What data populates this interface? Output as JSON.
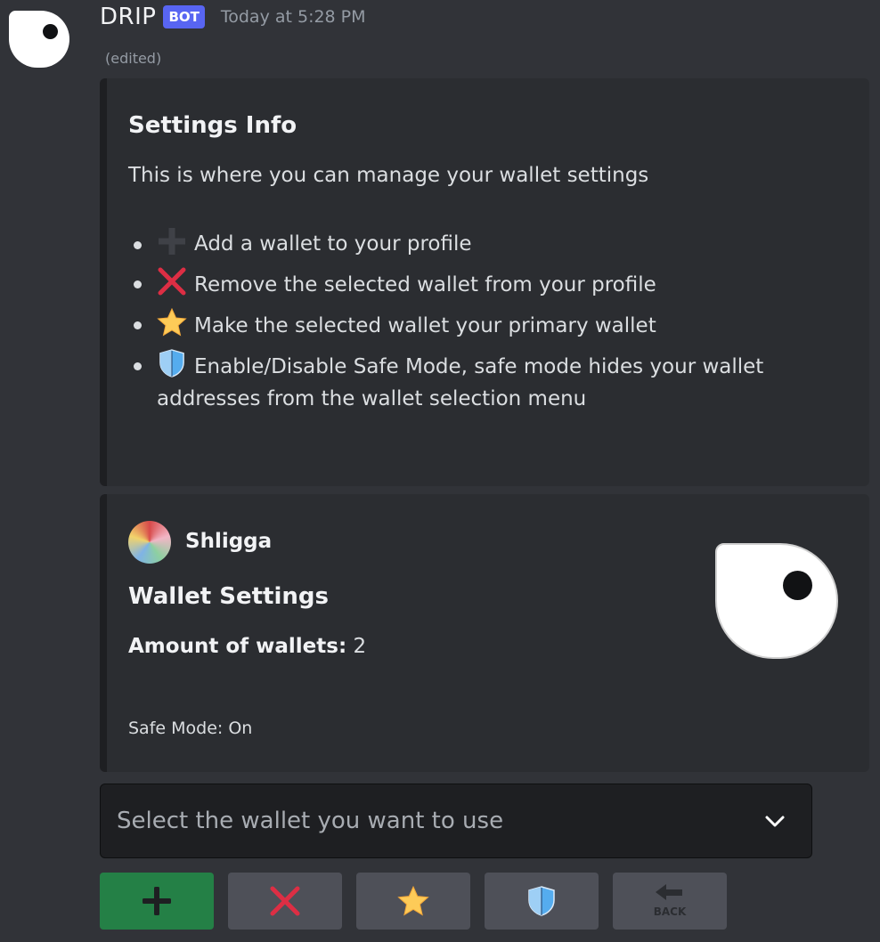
{
  "message": {
    "author": "DRIP",
    "bot_tag": "BOT",
    "timestamp": "Today at 5:28 PM",
    "edited": "(edited)"
  },
  "settings_embed": {
    "title": "Settings Info",
    "description": "This is where you can manage your wallet settings",
    "items": [
      {
        "icon": "plus-icon",
        "text": "Add a wallet to your profile"
      },
      {
        "icon": "x-icon",
        "text": "Remove the selected wallet from your profile"
      },
      {
        "icon": "star-icon",
        "text": "Make the selected wallet your primary wallet"
      },
      {
        "icon": "shield-icon",
        "text": "Enable/Disable Safe Mode, safe mode hides your wallet addresses from the wallet selection menu"
      }
    ]
  },
  "wallet_embed": {
    "author": "Shligga",
    "title": "Wallet Settings",
    "field_label": "Amount of wallets:",
    "field_value": "2",
    "footer": "Safe Mode: On"
  },
  "select": {
    "placeholder": "Select the wallet you want to use"
  },
  "buttons": {
    "back_label": "BACK"
  },
  "colors": {
    "background": "#313338",
    "embed": "#2b2d31",
    "bot_tag": "#5865f2",
    "success_button": "#248046",
    "secondary_button": "#4e5058",
    "danger_red": "#dd2e44",
    "star_yellow": "#fdcb58",
    "shield_blue": "#55acee"
  }
}
